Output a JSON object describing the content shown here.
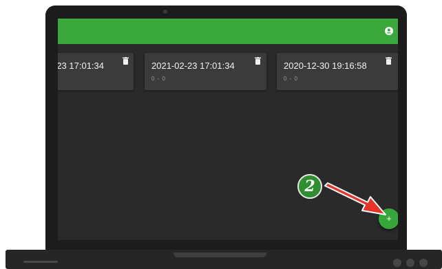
{
  "cards": [
    {
      "title": "-23 17:01:34",
      "subtitle": ""
    },
    {
      "title": "2021-02-23 17:01:34",
      "subtitle": "0 - 0"
    },
    {
      "title": "2020-12-30 19:16:58",
      "subtitle": "0 - 0"
    }
  ],
  "fab": {
    "label": "+"
  },
  "annotation": {
    "step": "2"
  },
  "colors": {
    "appbar": "#3aa83a",
    "fab": "#35a63a",
    "background": "#2a2a2a",
    "card": "#3b3b3b",
    "arrow": "#e8332a"
  },
  "icons": {
    "account": "account-circle-icon",
    "delete": "trash-icon",
    "add": "plus-icon"
  }
}
